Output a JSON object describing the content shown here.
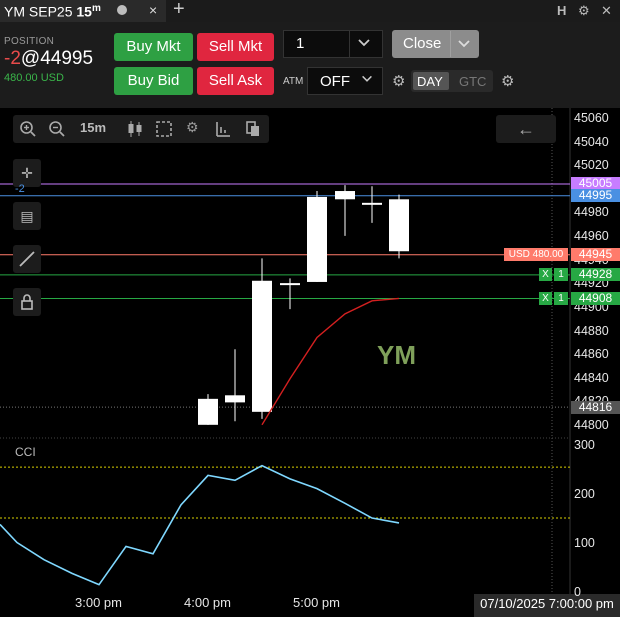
{
  "tab": {
    "symbol": "YM SEP25",
    "interval": "15",
    "interval_unit": "m",
    "close": "×",
    "add": "+"
  },
  "top_icons": [
    "H",
    "⚙",
    "✕"
  ],
  "position": {
    "label": "POSITION",
    "qty": "-2",
    "price": "@44995",
    "pnl": "480.00 USD"
  },
  "buttons": {
    "buy_mkt": "Buy Mkt",
    "sell_mkt": "Sell Mkt",
    "buy_bid": "Buy Bid",
    "sell_ask": "Sell Ask",
    "close": "Close"
  },
  "quantity": {
    "value": "1"
  },
  "atm": {
    "label": "ATM",
    "value": "OFF"
  },
  "tif": {
    "day": "DAY",
    "gtc": "GTC"
  },
  "toolbar": {
    "interval_label": "15m"
  },
  "chart_data": {
    "type": "candlestick",
    "symbol_watermark": "YM",
    "price_axis": {
      "ticks": [
        45060,
        45040,
        45020,
        45000,
        44980,
        44960,
        44940,
        44920,
        44900,
        44880,
        44860,
        44840,
        44820,
        44800
      ]
    },
    "time_axis": {
      "labels": [
        "3:00 pm",
        "4:00 pm",
        "5:00 pm"
      ]
    },
    "crosshair_time": "07/10/2025 7:00:00 pm",
    "candles": [
      {
        "o": 44801,
        "h": 44827,
        "c": 44823,
        "l": 44801,
        "color": "white"
      },
      {
        "o": 44820,
        "h": 44865,
        "c": 44826,
        "l": 44804,
        "color": "white"
      },
      {
        "o": 44812,
        "h": 44942,
        "c": 44923,
        "l": 44806,
        "color": "white"
      },
      {
        "o": 44921,
        "h": 44925,
        "c": 44920,
        "l": 44899,
        "color": "white"
      },
      {
        "o": 44922,
        "h": 44999,
        "c": 44994,
        "l": 44922,
        "color": "white"
      },
      {
        "o": 44992,
        "h": 45004,
        "c": 44999,
        "l": 44961,
        "color": "white"
      },
      {
        "o": 44989,
        "h": 45003,
        "c": 44989,
        "l": 44972,
        "color": "white"
      },
      {
        "o": 44992,
        "h": 44996,
        "c": 44948,
        "l": 44942,
        "color": "white"
      }
    ],
    "moving_average": {
      "color": "#d42020",
      "values": [
        null,
        null,
        null,
        44801,
        44840,
        44875,
        44895,
        44906,
        44908
      ]
    },
    "levels": [
      {
        "name": "upper",
        "price": 45005,
        "tag": "45005",
        "color": "#c77dff"
      },
      {
        "name": "position",
        "price": 44995,
        "tag": "44995",
        "color": "#4a90e2",
        "marker": "-2"
      },
      {
        "name": "pnl",
        "price": 44945,
        "tag": "44945",
        "color": "#ff7b6b",
        "label": "USD 480.00"
      },
      {
        "name": "order1",
        "price": 44928,
        "tag": "44928",
        "color": "#27a844",
        "label_x": "X",
        "label_qty": "1"
      },
      {
        "name": "order2",
        "price": 44908,
        "tag": "44908",
        "color": "#27a844",
        "label_x": "X",
        "label_qty": "1"
      },
      {
        "name": "last",
        "price": 44816,
        "tag": "44816",
        "color": "#777777"
      }
    ],
    "cci": {
      "label": "CCI",
      "ticks": [
        300,
        200,
        100,
        0
      ],
      "levels": [
        257,
        153
      ],
      "values": [
        140,
        103,
        68,
        40,
        17,
        95,
        80,
        180,
        240,
        230,
        260,
        233,
        213,
        183,
        153,
        143
      ]
    }
  }
}
